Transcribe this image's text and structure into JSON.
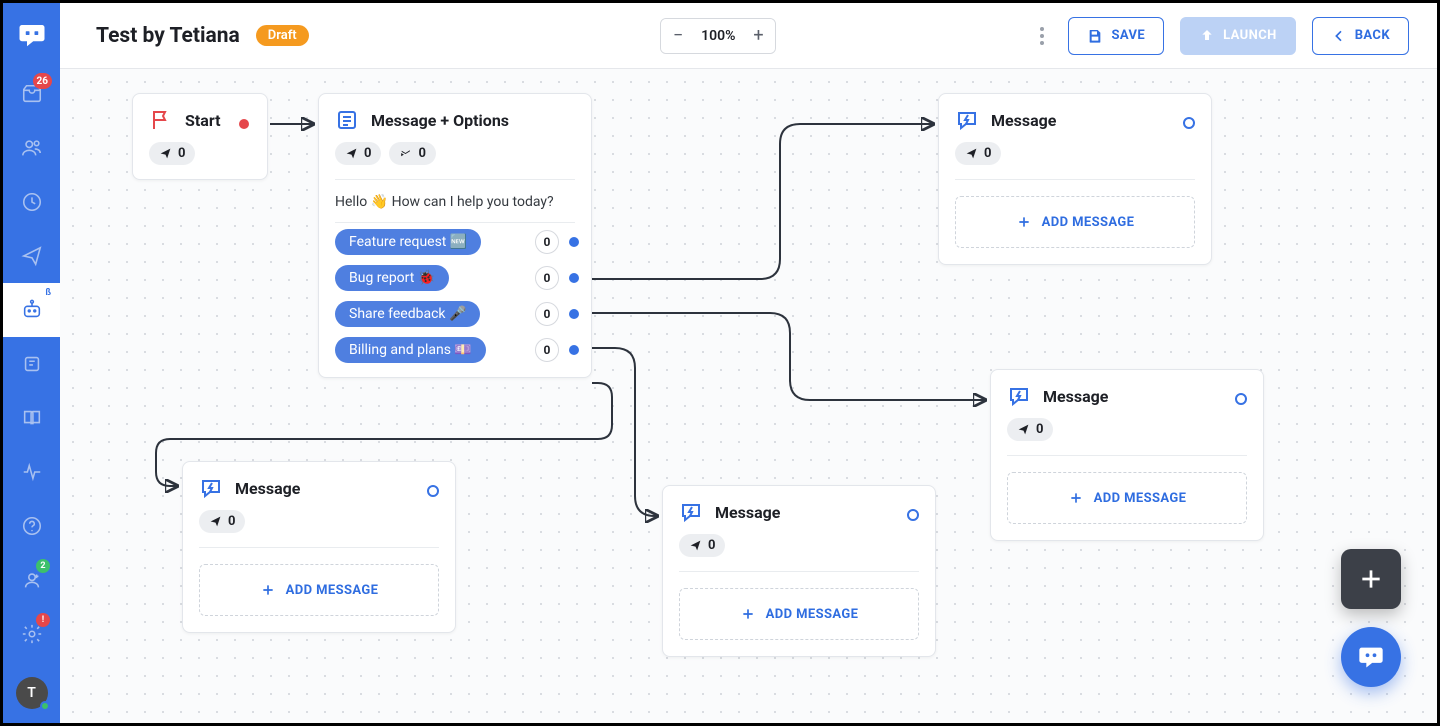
{
  "sidebar": {
    "inbox_badge": "26",
    "team_badge": "2",
    "alert_badge": "!",
    "beta_tag": "ß",
    "avatar_initial": "T"
  },
  "header": {
    "title": "Test by Tetiana",
    "status": "Draft",
    "zoom": "100%",
    "save": "SAVE",
    "launch": "LAUNCH",
    "back": "BACK"
  },
  "nodes": {
    "start": {
      "title": "Start",
      "sent": "0"
    },
    "msgopts": {
      "title": "Message + Options",
      "sent": "0",
      "recv": "0",
      "body": "Hello 👋 How can I help you today?",
      "options": [
        {
          "label": "Feature request 🆕",
          "count": "0"
        },
        {
          "label": "Bug report 🐞",
          "count": "0"
        },
        {
          "label": "Share feedback 🎤",
          "count": "0"
        },
        {
          "label": "Billing and plans 💷",
          "count": "0"
        }
      ]
    },
    "msg": {
      "title": "Message",
      "sent": "0",
      "add": "ADD MESSAGE"
    }
  }
}
